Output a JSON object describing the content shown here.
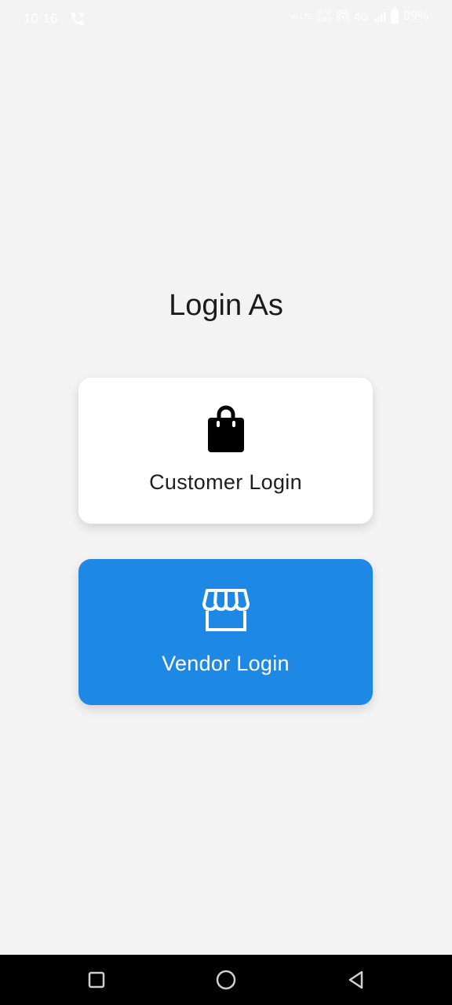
{
  "status_bar": {
    "time": "10:16",
    "volte_label": "Vo LTE",
    "speed_value": "0.00",
    "speed_unit": "KB/s",
    "network": "4G",
    "battery": "99%"
  },
  "page": {
    "title": "Login As"
  },
  "cards": {
    "customer": {
      "label": "Customer Login",
      "icon": "shopping-bag-icon",
      "bg_color": "#ffffff"
    },
    "vendor": {
      "label": "Vendor Login",
      "icon": "storefront-icon",
      "bg_color": "#1e88e5"
    }
  },
  "nav_bar": {
    "recent_icon": "square-icon",
    "home_icon": "circle-icon",
    "back_icon": "triangle-back-icon"
  }
}
